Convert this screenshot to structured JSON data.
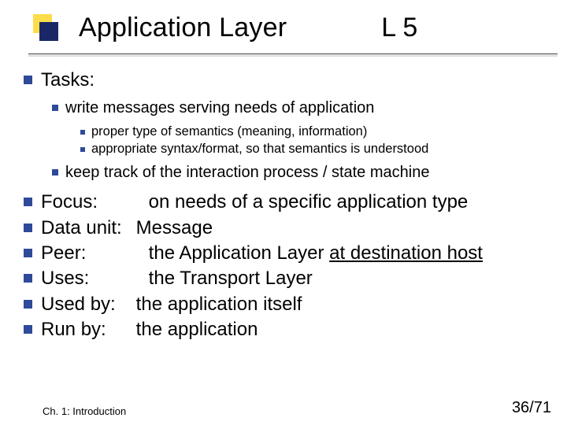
{
  "title": {
    "main": "Application Layer",
    "right": "L 5"
  },
  "bullets": {
    "tasks_label": "Tasks:",
    "task1": "write messages serving needs of application",
    "task1_sub1": "proper type of semantics (meaning, information)",
    "task1_sub2": "appropriate syntax/format, so that semantics is understood",
    "task2": "keep track of the interaction process / state machine"
  },
  "pairs": {
    "focus": {
      "label": "Focus:",
      "value": "on needs of a specific application type"
    },
    "dataunit": {
      "label": "Data unit:",
      "value": "Message"
    },
    "peer": {
      "label": "Peer:",
      "value_pre": "the Application Layer ",
      "value_ul": "at destination host"
    },
    "uses": {
      "label": "Uses:",
      "value": "the Transport Layer"
    },
    "usedby": {
      "label": "Used by:",
      "value": "the application itself"
    },
    "runby": {
      "label": "Run by:",
      "value": "the application"
    }
  },
  "footer": {
    "left": "Ch. 1: Introduction",
    "right": "36/71"
  }
}
